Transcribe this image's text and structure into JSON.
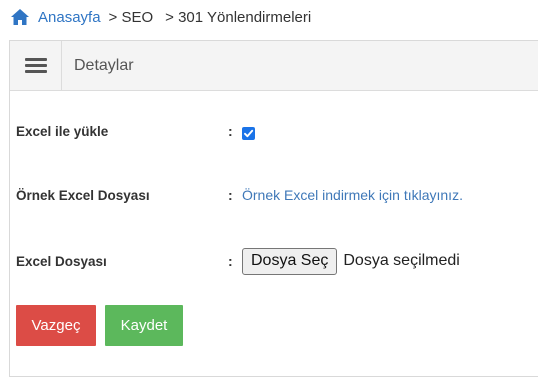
{
  "breadcrumb": {
    "home": "Anasayfa",
    "items": [
      "> SEO",
      "> 301 Yönlendirmeleri"
    ]
  },
  "panel": {
    "title": "Detaylar"
  },
  "form": {
    "upload_excel_label": "Excel ile yükle",
    "upload_excel_checked": true,
    "sample_file_label": "Örnek Excel Dosyası",
    "sample_file_link": "Örnek Excel indirmek için tıklayınız.",
    "excel_file_label": "Excel Dosyası",
    "file_button": "Dosya Seç",
    "file_status": "Dosya seçilmedi",
    "colon": ":"
  },
  "actions": {
    "cancel": "Vazgeç",
    "save": "Kaydet"
  },
  "colors": {
    "link": "#2f75c4",
    "cancel": "#dc4c46",
    "save": "#5cb85c",
    "checkbox": "#1a73e8"
  },
  "icons": {
    "home": "home-icon",
    "menu": "hamburger-menu-icon",
    "check": "checkmark-icon"
  }
}
